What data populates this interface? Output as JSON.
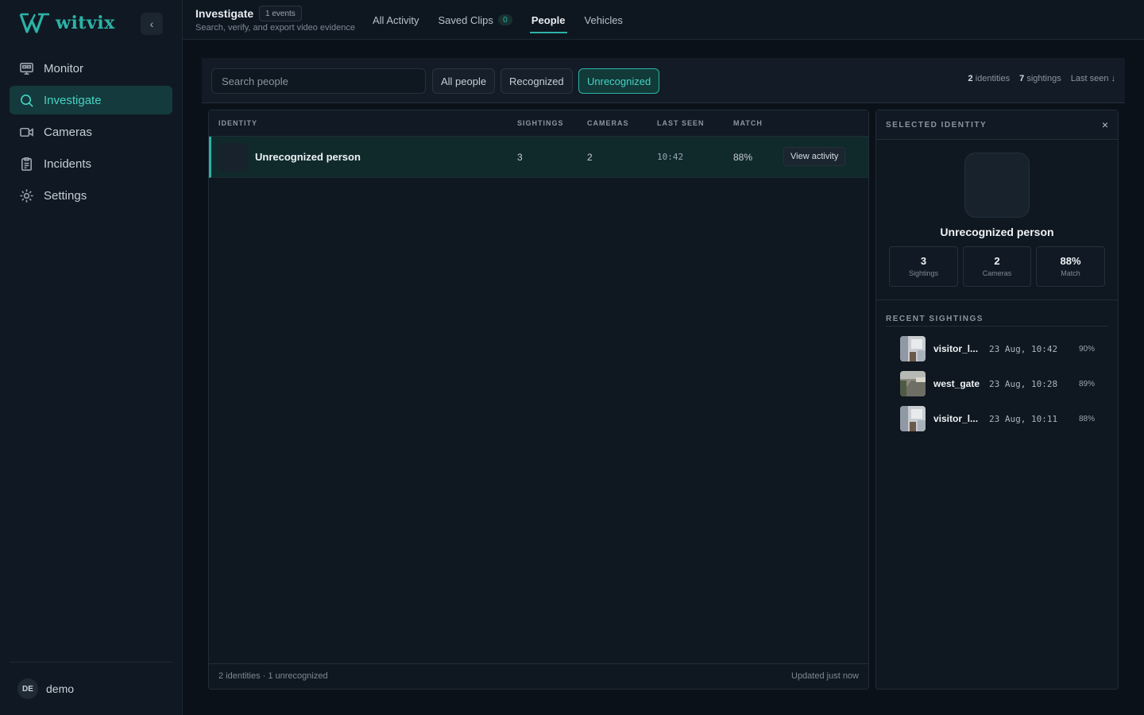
{
  "app": {
    "logo_text": "witvix"
  },
  "sidebar": {
    "collapse_icon": "chevron-left-icon",
    "items": [
      {
        "label": "Monitor",
        "icon": "monitor-icon",
        "active": false
      },
      {
        "label": "Investigate",
        "icon": "search-icon",
        "active": true
      },
      {
        "label": "Cameras",
        "icon": "camera-icon",
        "active": false
      },
      {
        "label": "Incidents",
        "icon": "clipboard-icon",
        "active": false
      },
      {
        "label": "Settings",
        "icon": "gear-icon",
        "active": false
      }
    ],
    "user": {
      "initials": "DE",
      "name": "demo"
    }
  },
  "header": {
    "title": "Investigate",
    "events_badge": "1 events",
    "subtitle": "Search, verify, and export video evidence",
    "tabs": [
      {
        "label": "All Activity"
      },
      {
        "label": "Saved Clips",
        "count": "0"
      },
      {
        "label": "People",
        "active": true
      },
      {
        "label": "Vehicles"
      }
    ]
  },
  "filters": {
    "search_placeholder": "Search people",
    "chips": [
      "All people",
      "Recognized",
      "Unrecognized"
    ],
    "active_chip": "Unrecognized",
    "stats": {
      "identities_count": "2",
      "identities_label": "identities",
      "sightings_count": "7",
      "sightings_label": "sightings",
      "sort_label": "Last seen ↓"
    }
  },
  "table": {
    "columns": [
      "IDENTITY",
      "SIGHTINGS",
      "CAMERAS",
      "LAST SEEN",
      "MATCH"
    ],
    "rows": [
      {
        "name": "Unrecognized person",
        "sightings": "3",
        "cameras": "2",
        "last_seen": "10:42",
        "match": "88%",
        "action": "View activity"
      }
    ],
    "footer_left": "2 identities · 1 unrecognized",
    "footer_right": "Updated just now"
  },
  "detail": {
    "title": "SELECTED IDENTITY",
    "close": "×",
    "name": "Unrecognized person",
    "stats": [
      {
        "value": "3",
        "label": "Sightings"
      },
      {
        "value": "2",
        "label": "Cameras"
      },
      {
        "value": "88%",
        "label": "Match"
      }
    ],
    "recent_title": "RECENT SIGHTINGS",
    "sightings": [
      {
        "camera": "visitor_l...",
        "time": "23 Aug, 10:42",
        "match": "90%"
      },
      {
        "camera": "west_gate",
        "time": "23 Aug, 10:28",
        "match": "89%"
      },
      {
        "camera": "visitor_l...",
        "time": "23 Aug, 10:11",
        "match": "88%"
      }
    ]
  },
  "colors": {
    "accent": "#2cb3a7",
    "background": "#0b1119",
    "sidebar": "#101923"
  }
}
